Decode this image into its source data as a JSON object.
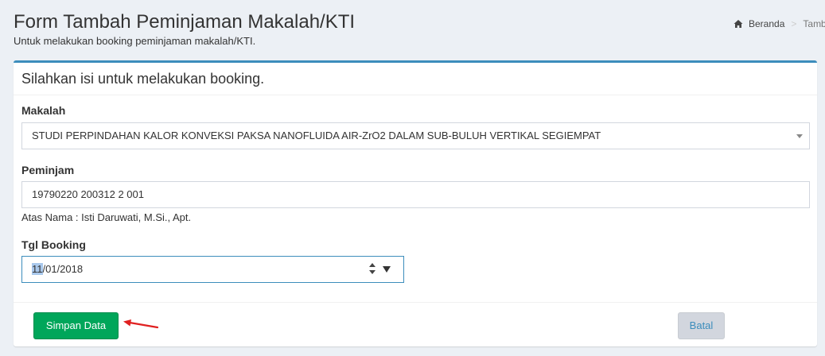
{
  "header": {
    "title": "Form Tambah Peminjaman Makalah/KTI",
    "subtitle": "Untuk melakukan booking peminjaman makalah/KTI."
  },
  "breadcrumb": {
    "home_label": "Beranda",
    "separator": ">",
    "current": "Tamb"
  },
  "box": {
    "title": "Silahkan isi untuk melakukan booking."
  },
  "form": {
    "makalah": {
      "label": "Makalah",
      "selected": "STUDI PERPINDAHAN KALOR KONVEKSI PAKSA NANOFLUIDA AIR-ZrO2 DALAM SUB-BULUH VERTIKAL SEGIEMPAT"
    },
    "peminjam": {
      "label": "Peminjam",
      "value": "19790220 200312 2 001",
      "help": "Atas Nama : Isti Daruwati, M.Si., Apt."
    },
    "tgl_booking": {
      "label": "Tgl Booking",
      "value_selected_part": "11",
      "value_rest": "/01/2018"
    }
  },
  "footer": {
    "save_label": "Simpan Data",
    "cancel_label": "Batal"
  },
  "colors": {
    "accent": "#3c8dbc",
    "save_button": "#00a65a",
    "annotation_arrow": "#e02020"
  },
  "icons": {
    "home": "home-icon",
    "annotation": "red-arrow-icon"
  }
}
